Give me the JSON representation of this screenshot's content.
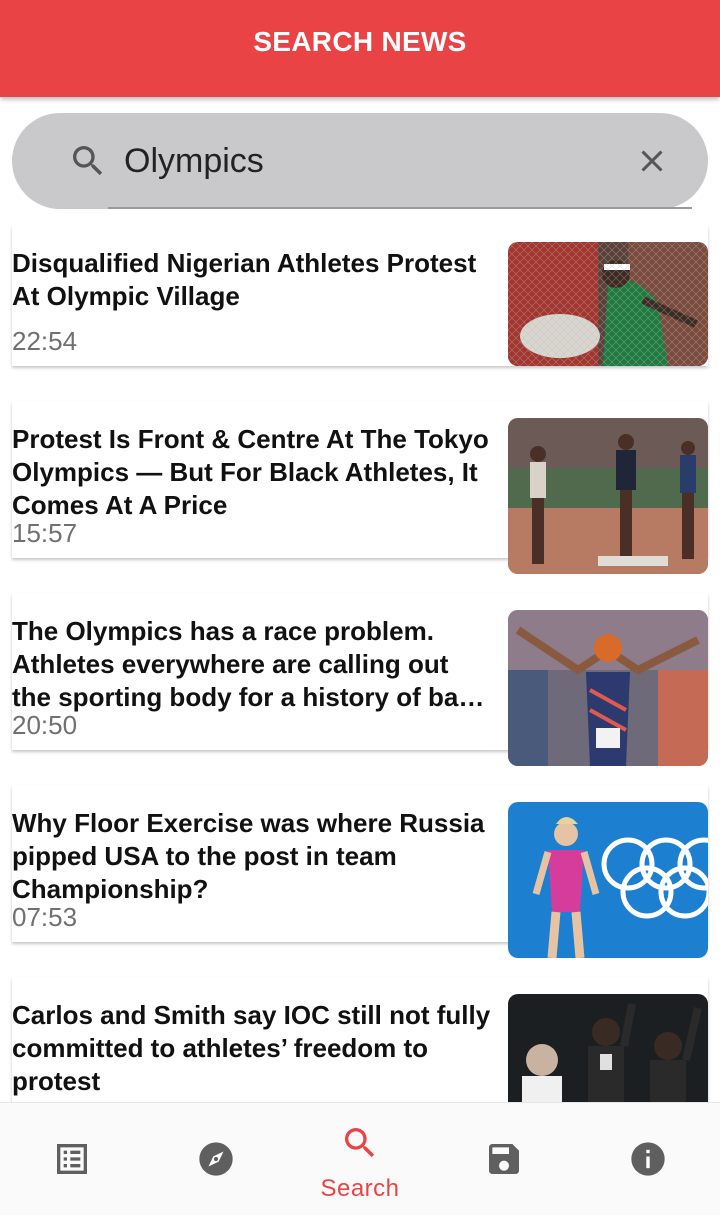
{
  "app_bar": {
    "title": "SEARCH NEWS"
  },
  "search": {
    "query": "Olympics"
  },
  "icons": {
    "search": "search-icon",
    "clear": "close-icon",
    "nav": [
      "list-icon",
      "compass-icon",
      "search-icon",
      "save-icon",
      "info-icon"
    ]
  },
  "articles": [
    {
      "title": "Disqualified Nigerian Athletes Protest At Olympic Village",
      "time": "22:54"
    },
    {
      "title": "Protest Is Front & Centre At The Tokyo Olympics — But For Black Athletes, It Comes At A Price",
      "time": "15:57"
    },
    {
      "title": "The Olympics has a race problem. Athletes everywhere are calling out the sporting body for a history of ba…",
      "time": "20:50"
    },
    {
      "title": "Why Floor Exercise was where Russia pipped USA to the post in team Championship?",
      "time": "07:53"
    },
    {
      "title": "Carlos and Smith say IOC still not fully committed to athletes’ freedom to protest",
      "time": ""
    }
  ],
  "bottom_nav": {
    "active_label": "Search"
  },
  "colors": {
    "primary": "#e94346",
    "search_bg": "#c9c9cb",
    "icon_gray": "#5f5f5f",
    "time_gray": "#707070"
  }
}
